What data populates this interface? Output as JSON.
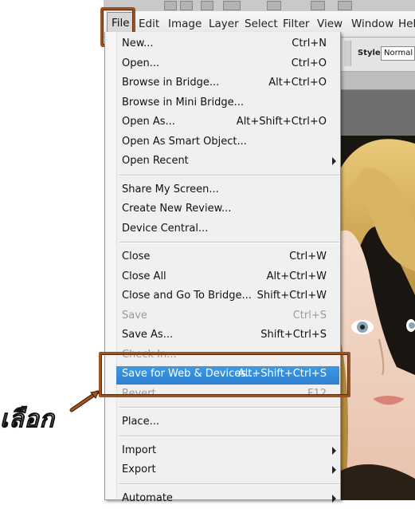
{
  "menubar": {
    "items": [
      "File",
      "Edit",
      "Image",
      "Layer",
      "Select",
      "Filter",
      "View",
      "Window",
      "Hel"
    ]
  },
  "options_bar": {
    "style_label": "Style:",
    "style_value": "Normal"
  },
  "file_menu": {
    "groups": [
      [
        {
          "label": "New...",
          "shortcut": "Ctrl+N"
        },
        {
          "label": "Open...",
          "shortcut": "Ctrl+O"
        },
        {
          "label": "Browse in Bridge...",
          "shortcut": "Alt+Ctrl+O"
        },
        {
          "label": "Browse in Mini Bridge...",
          "shortcut": ""
        },
        {
          "label": "Open As...",
          "shortcut": "Alt+Shift+Ctrl+O"
        },
        {
          "label": "Open As Smart Object...",
          "shortcut": ""
        },
        {
          "label": "Open Recent",
          "shortcut": "",
          "submenu": true
        }
      ],
      [
        {
          "label": "Share My Screen...",
          "shortcut": ""
        },
        {
          "label": "Create New Review...",
          "shortcut": ""
        },
        {
          "label": "Device Central...",
          "shortcut": ""
        }
      ],
      [
        {
          "label": "Close",
          "shortcut": "Ctrl+W"
        },
        {
          "label": "Close All",
          "shortcut": "Alt+Ctrl+W"
        },
        {
          "label": "Close and Go To Bridge...",
          "shortcut": "Shift+Ctrl+W"
        },
        {
          "label": "Save",
          "shortcut": "Ctrl+S",
          "disabled": true
        },
        {
          "label": "Save As...",
          "shortcut": "Shift+Ctrl+S"
        },
        {
          "label": "Check In...",
          "shortcut": "",
          "disabled": true
        },
        {
          "label": "Save for Web & Devices...",
          "shortcut": "Alt+Shift+Ctrl+S",
          "selected": true
        },
        {
          "label": "Revert",
          "shortcut": "F12",
          "disabled": true
        }
      ],
      [
        {
          "label": "Place...",
          "shortcut": ""
        }
      ],
      [
        {
          "label": "Import",
          "shortcut": "",
          "submenu": true
        },
        {
          "label": "Export",
          "shortcut": "",
          "submenu": true
        }
      ],
      [
        {
          "label": "Automate",
          "shortcut": "",
          "submenu": true
        }
      ]
    ]
  },
  "annotation": {
    "text": "เลือก",
    "color": "#a0521d"
  },
  "colors": {
    "highlight_border": "#a0521d",
    "selection": "#3588d6"
  }
}
